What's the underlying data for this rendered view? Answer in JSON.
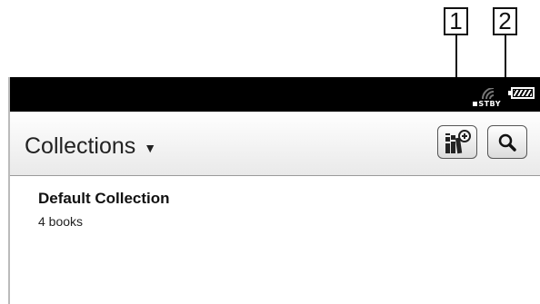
{
  "callouts": [
    "1",
    "2"
  ],
  "status_bar": {
    "standby_label": "STBY",
    "icons": [
      "wifi-icon",
      "battery-icon"
    ]
  },
  "header": {
    "title": "Collections",
    "dropdown_icon": "▼",
    "buttons": [
      "add-collection-icon",
      "search-icon"
    ]
  },
  "collections": [
    {
      "name": "Default Collection",
      "count": "4 books"
    }
  ]
}
